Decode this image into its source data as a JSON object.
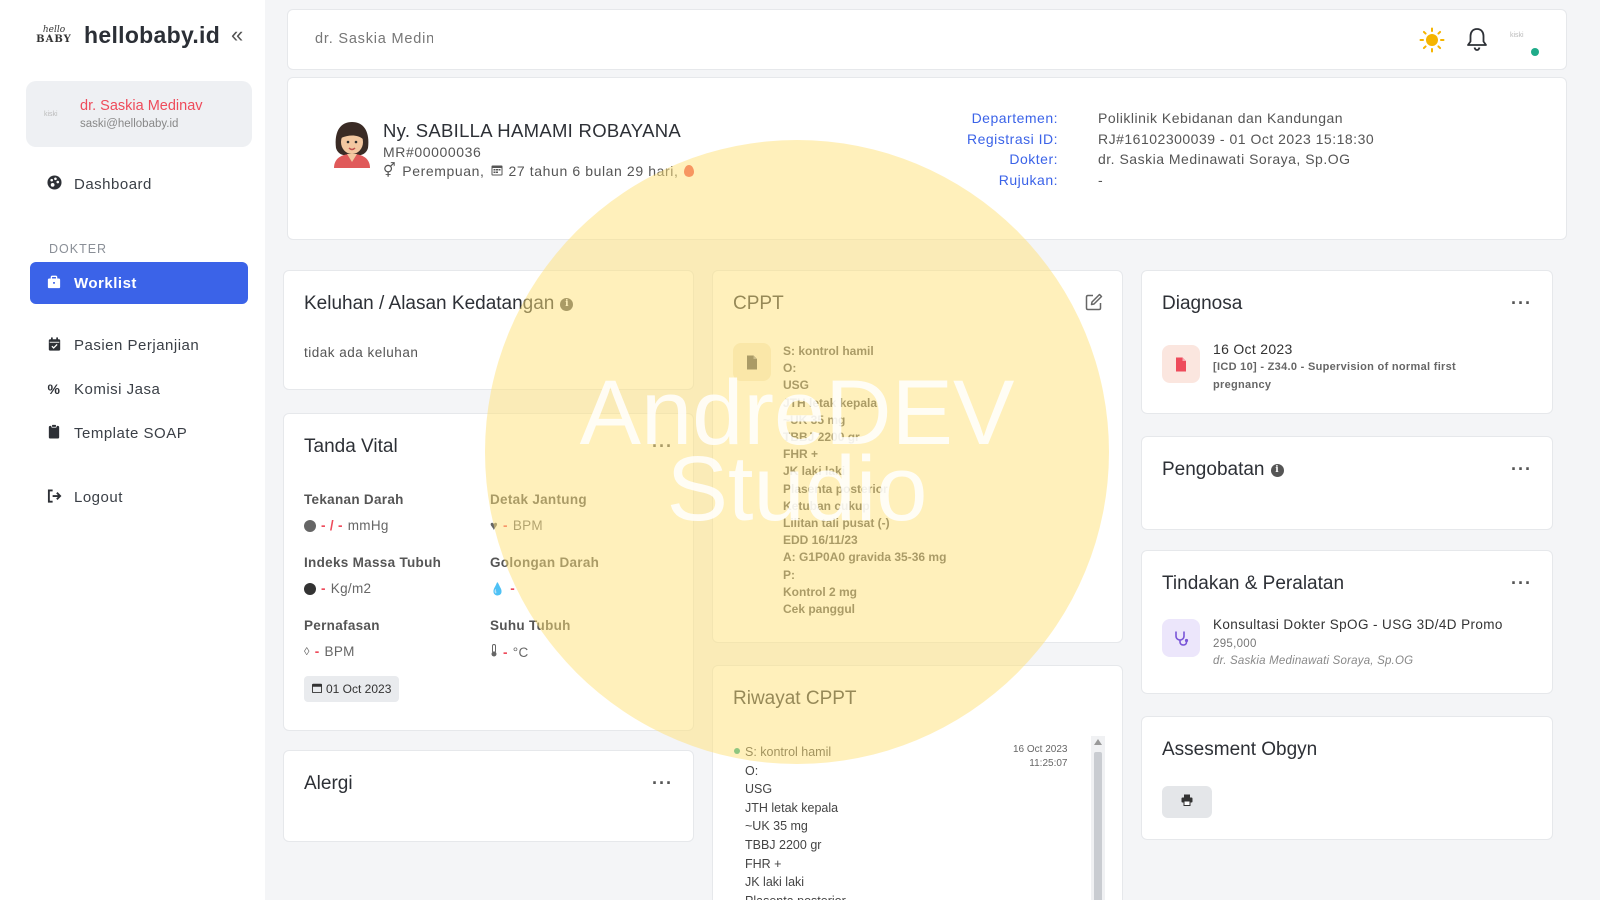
{
  "brand": {
    "name": "hellobaby.id",
    "logo_top": "hello",
    "logo_bottom": "BABY"
  },
  "sidebar": {
    "user": {
      "name": "dr. Saskia Medinav",
      "email": "saski@hellobaby.id",
      "avatar_text": "kiski"
    },
    "section_label": "DOKTER",
    "items": [
      {
        "label": "Dashboard",
        "icon": "palette-icon"
      },
      {
        "label": "Worklist",
        "icon": "briefcase-icon",
        "active": true
      },
      {
        "label": "Pasien Perjanjian",
        "icon": "calendar-check-icon"
      },
      {
        "label": "Komisi Jasa",
        "icon": "percent-icon"
      },
      {
        "label": "Template SOAP",
        "icon": "clipboard-icon"
      },
      {
        "label": "Logout",
        "icon": "logout-icon"
      }
    ]
  },
  "topbar": {
    "doctor_name": "dr. Saskia Medinawati",
    "avatar_text": "kiski",
    "status_color": "#1fab89"
  },
  "patient": {
    "name": "Ny. SABILLA HAMAMI ROBAYANA",
    "mr": "MR#00000036",
    "info": "Perempuan,",
    "age": "27 tahun 6 bulan 29 hari,",
    "meta_labels": {
      "dept": "Departemen:",
      "reg": "Registrasi ID:",
      "doctor": "Dokter:",
      "ref": "Rujukan:"
    },
    "meta_values": {
      "dept": "Poliklinik Kebidanan dan Kandungan",
      "reg": "RJ#16102300039 - 01 Oct 2023 15:18:30",
      "doctor": "dr. Saskia Medinawati Soraya, Sp.OG",
      "ref": "-"
    }
  },
  "complaint": {
    "title": "Keluhan / Alasan Kedatangan",
    "text": "tidak ada keluhan"
  },
  "vitals": {
    "title": "Tanda Vital",
    "bp": {
      "label": "Tekanan Darah",
      "value": "- / -",
      "unit": "mmHg"
    },
    "hr": {
      "label": "Detak Jantung",
      "value": "-",
      "unit": "BPM"
    },
    "bmi": {
      "label": "Indeks Massa Tubuh",
      "value": "-",
      "unit": "Kg/m2"
    },
    "blood": {
      "label": "Golongan Darah",
      "value": "-"
    },
    "resp": {
      "label": "Pernafasan",
      "value": "-",
      "unit": "BPM"
    },
    "temp": {
      "label": "Suhu Tubuh",
      "value": "-",
      "unit": "°C"
    },
    "date": "01 Oct 2023"
  },
  "allergy": {
    "title": "Alergi"
  },
  "cppt": {
    "title": "CPPT",
    "lines": [
      "S: kontrol hamil",
      "O:",
      "USG",
      "JTH letak kepala",
      "~UK 35 mg",
      "TBBJ 2200 gr",
      "FHR +",
      "JK laki laki",
      "Plasenta posterior",
      "Ketuban cukup",
      "Lilitan tali pusat (-)",
      "EDD 16/11/23",
      "A: G1P0A0 gravida 35-36 mg",
      "P:",
      "Kontrol 2 mg",
      "Cek panggul"
    ]
  },
  "riwayat": {
    "title": "Riwayat CPPT",
    "date": "16 Oct 2023",
    "time": "11:25:07",
    "lines": [
      "S: kontrol hamil",
      "O:",
      "USG",
      "JTH letak kepala",
      "~UK 35 mg",
      "TBBJ 2200 gr",
      "FHR +",
      "JK laki laki",
      "Plasenta posterior"
    ]
  },
  "diagnosa": {
    "title": "Diagnosa",
    "date": "16 Oct 2023",
    "text": "[ICD 10] - Z34.0 - Supervision of normal first pregnancy"
  },
  "pengobatan": {
    "title": "Pengobatan"
  },
  "tindakan": {
    "title": "Tindakan & Peralatan",
    "name": "Konsultasi Dokter SpOG - USG 3D/4D Promo",
    "price": "295,000",
    "doctor": "dr. Saskia Medinawati Soraya, Sp.OG"
  },
  "assesment": {
    "title": "Assesment Obgyn"
  },
  "watermark": {
    "line1": "AndreDEV",
    "line2": "Studio"
  }
}
